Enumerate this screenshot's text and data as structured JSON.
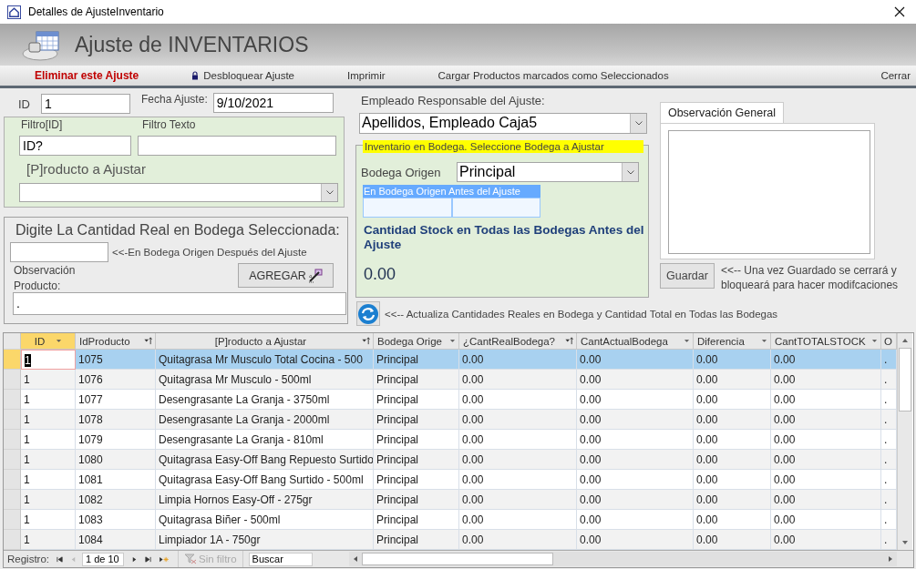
{
  "window": {
    "title": "Detalles de AjusteInventario"
  },
  "header": {
    "title": "Ajuste de INVENTARIOS"
  },
  "toolbar": [
    {
      "label": "Eliminar este Ajuste",
      "kind": "danger"
    },
    {
      "label": "Desbloquear Ajuste",
      "kind": "lock"
    },
    {
      "label": "Imprimir",
      "kind": "plain"
    },
    {
      "label": "Cargar Productos marcados como Seleccionados",
      "kind": "plain"
    },
    {
      "label": "Cerrar",
      "kind": "end"
    }
  ],
  "id_field": {
    "label": "ID",
    "value": "1"
  },
  "date_field": {
    "label": "Fecha Ajuste:",
    "value": "9/10/2021"
  },
  "filter": {
    "id_label": "Filtro[ID]",
    "id_value": "ID?",
    "text_label": "Filtro Texto",
    "product_label": "[P]roducto a Ajustar"
  },
  "quantity": {
    "title": "Digite La Cantidad Real en Bodega Seleccionada:",
    "hint": "<<-En Bodega Origen Después del Ajuste",
    "obs_label": "Observación Producto:",
    "obs_value": ".",
    "button": "AGREGAR"
  },
  "employee": {
    "label": "Empleado Responsable del Ajuste:",
    "value": "Apellidos, Empleado Caja5"
  },
  "bodega": {
    "legend": "Inventario en Bodega. Seleccione Bodega a Ajustar",
    "origin_label": "Bodega Origen",
    "origin_value": "Principal",
    "mini_header": "En Bodega Origen Antes del Ajuste",
    "stock_label": "Cantidad Stock en Todas las Bodegas Antes del Ajuste",
    "stock_value": "0.00"
  },
  "refresh_note": "<<-- Actualiza Cantidades Reales en Bodega y Cantidad Total en Todas las Bodegas",
  "observation": {
    "tab": "Observación General",
    "save_button": "Guardar",
    "save_note": "<<-- Una vez Guardado se cerrará y bloqueará para hacer modifcaciones"
  },
  "table": {
    "columns": [
      {
        "label": "ID",
        "kind": "menu"
      },
      {
        "label": "IdProducto",
        "kind": "sorted"
      },
      {
        "label": "[P]roducto a Ajustar",
        "kind": "sorted"
      },
      {
        "label": "Bodega Orige",
        "kind": "menu"
      },
      {
        "label": "¿CantRealBodega?",
        "kind": "sorted"
      },
      {
        "label": "CantActualBodega",
        "kind": "menu"
      },
      {
        "label": "Diferencia",
        "kind": "menu"
      },
      {
        "label": "CantTOTALSTOCK",
        "kind": "menu"
      },
      {
        "label": "O",
        "kind": "plain"
      }
    ],
    "rows": [
      {
        "selected": true,
        "cells": [
          "1",
          "1075",
          "Quitagrasa Mr Musculo Total Cocina - 500",
          "Principal",
          "0.00",
          "0.00",
          "0.00",
          "0.00",
          "."
        ]
      },
      {
        "selected": false,
        "cells": [
          "1",
          "1076",
          "Quitagrasa Mr Musculo - 500ml",
          "Principal",
          "0.00",
          "0.00",
          "0.00",
          "0.00",
          "."
        ]
      },
      {
        "selected": false,
        "cells": [
          "1",
          "1077",
          "Desengrasante La Granja - 3750ml",
          "Principal",
          "0.00",
          "0.00",
          "0.00",
          "0.00",
          "."
        ]
      },
      {
        "selected": false,
        "cells": [
          "1",
          "1078",
          "Desengrasante La Granja - 2000ml",
          "Principal",
          "0.00",
          "0.00",
          "0.00",
          "0.00",
          "."
        ]
      },
      {
        "selected": false,
        "cells": [
          "1",
          "1079",
          "Desengrasante La Granja - 810ml",
          "Principal",
          "0.00",
          "0.00",
          "0.00",
          "0.00",
          "."
        ]
      },
      {
        "selected": false,
        "cells": [
          "1",
          "1080",
          "Quitagrasa Easy-Off Bang Repuesto Surtido",
          "Principal",
          "0.00",
          "0.00",
          "0.00",
          "0.00",
          "."
        ]
      },
      {
        "selected": false,
        "cells": [
          "1",
          "1081",
          "Quitagrasa Easy-Off Bang Surtido - 500ml",
          "Principal",
          "0.00",
          "0.00",
          "0.00",
          "0.00",
          "."
        ]
      },
      {
        "selected": false,
        "cells": [
          "1",
          "1082",
          "Limpia Hornos Easy-Off - 275gr",
          "Principal",
          "0.00",
          "0.00",
          "0.00",
          "0.00",
          "."
        ]
      },
      {
        "selected": false,
        "cells": [
          "1",
          "1083",
          "Quitagrasa Biñer - 500ml",
          "Principal",
          "0.00",
          "0.00",
          "0.00",
          "0.00",
          "."
        ]
      },
      {
        "selected": false,
        "cells": [
          "1",
          "1084",
          "Limpiador 1A - 750gr",
          "Principal",
          "0.00",
          "0.00",
          "0.00",
          "0.00",
          "."
        ]
      }
    ]
  },
  "nav": {
    "label": "Registro:",
    "position": "1 de 10",
    "filter": "Sin filtro",
    "search": "Buscar"
  }
}
